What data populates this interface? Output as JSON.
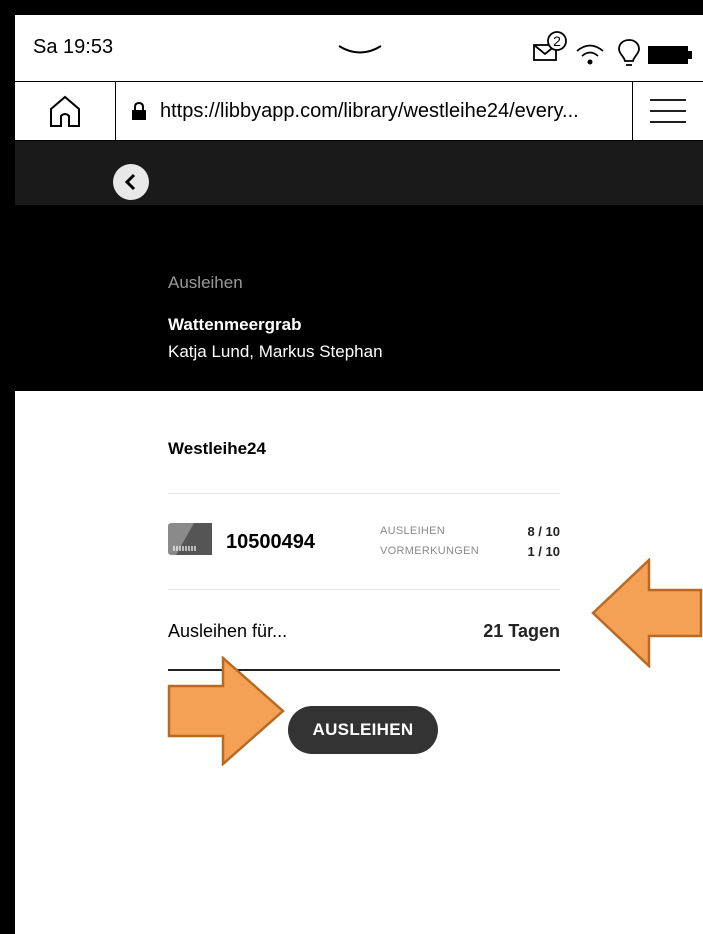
{
  "status_bar": {
    "time": "Sa 19:53",
    "notification_count": "2",
    "icons": [
      "mail-notification-icon",
      "wifi-icon",
      "lightbulb-icon",
      "battery-icon"
    ]
  },
  "browser": {
    "url": "https://libbyapp.com/library/westleihe24/every..."
  },
  "header": {
    "subtitle": "Ausleihen",
    "title": "Wattenmeergrab",
    "authors": "Katja Lund, Markus Stephan"
  },
  "library": {
    "name": "Westleihe24",
    "card_number": "10500494",
    "limits": [
      {
        "label": "AUSLEIHEN",
        "value": "8 / 10"
      },
      {
        "label": "VORMERKUNGEN",
        "value": "1 / 10"
      }
    ]
  },
  "loan": {
    "label": "Ausleihen für...",
    "value": "21 Tagen"
  },
  "actions": {
    "borrow_label": "AUSLEIHEN"
  },
  "colors": {
    "arrow_fill": "#F4A055",
    "arrow_stroke": "#B86A25",
    "header_bg": "#000000",
    "button_bg": "#333333"
  }
}
